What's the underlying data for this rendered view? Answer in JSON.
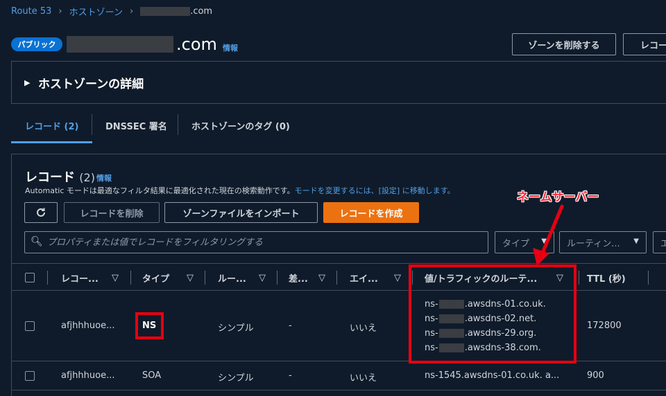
{
  "breadcrumb": {
    "root": "Route 53",
    "hosted_zones": "ホストゾーン",
    "domain_suffix": ".com"
  },
  "header": {
    "badge": "パブリック",
    "domain_suffix": ".com",
    "info": "情報",
    "delete_zone_button": "ゾーンを削除する",
    "create_record_button_partial": "レコー"
  },
  "details": {
    "title": "ホストゾーンの詳細"
  },
  "tabs": [
    {
      "label": "レコード (2)",
      "active": true
    },
    {
      "label": "DNSSEC 署名",
      "active": false
    },
    {
      "label": "ホストゾーンのタグ (0)",
      "active": false
    }
  ],
  "records": {
    "title": "レコード",
    "count": "(2)",
    "info": "情報",
    "desc_prefix": "Automatic",
    "desc_main": " モードは最適なフィルタ結果に最適化された現在の検索動作です。",
    "desc_link": "モードを変更するには、[設定] に移動します。",
    "refresh_icon": "refresh-icon",
    "delete_button": "レコードを削除",
    "import_button": "ゾーンファイルをインポート",
    "create_button": "レコードを作成",
    "search_placeholder": "プロパティまたは値でレコードをフィルタリングする",
    "type_filter": "タイプ",
    "routing_filter": "ルーティン...",
    "more_filter": "エ"
  },
  "table": {
    "columns": [
      "レコー...",
      "タイプ",
      "ルー...",
      "差...",
      "エイ...",
      "値/トラフィックのルーテ...",
      "TTL (秒)"
    ],
    "rows": [
      {
        "name": "afjhhhuoe...",
        "type": "NS",
        "routing": "シンプル",
        "diff": "-",
        "alias": "いいえ",
        "values": [
          {
            "prefix": "ns-",
            "suffix": ".awsdns-01.co.uk."
          },
          {
            "prefix": "ns-",
            "suffix": ".awsdns-02.net."
          },
          {
            "prefix": "ns-",
            "suffix": ".awsdns-29.org."
          },
          {
            "prefix": "ns-",
            "suffix": ".awsdns-38.com."
          }
        ],
        "ttl": "172800"
      },
      {
        "name": "afjhhhuoe...",
        "type": "SOA",
        "routing": "シンプル",
        "diff": "-",
        "alias": "いいえ",
        "value": "ns-1545.awsdns-01.co.uk. a...",
        "ttl": "900"
      }
    ]
  },
  "annotation": {
    "label": "ネームサーバー",
    "color": "#e60012"
  },
  "colors": {
    "background": "#0f1b2a",
    "link": "#539fe5",
    "primary_button": "#ec7211",
    "badge": "#0972d3"
  }
}
